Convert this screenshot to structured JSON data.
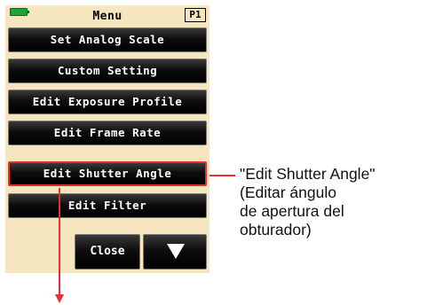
{
  "colors": {
    "screen_background": "#f5e6bf",
    "button_background": "#000000",
    "button_text": "#ffffff",
    "highlight": "#e53030",
    "battery": "#18a83a"
  },
  "status_bar": {
    "battery_icon": "battery-full-icon",
    "title": "Menu",
    "page_badge": "P1"
  },
  "menu": {
    "items": [
      {
        "label": "Set Analog Scale"
      },
      {
        "label": "Custom Setting"
      },
      {
        "label": "Edit Exposure Profile"
      },
      {
        "label": "Edit Frame Rate"
      },
      {
        "label": "Edit Shutter Angle",
        "highlighted": true
      },
      {
        "label": "Edit Filter"
      }
    ]
  },
  "bottom_bar": {
    "close_label": "Close",
    "next_page_icon": "down-triangle-icon"
  },
  "annotation": {
    "lines": [
      "\"Edit Shutter Angle\"",
      "(Editar ángulo",
      "de apertura del",
      "obturador)"
    ]
  }
}
